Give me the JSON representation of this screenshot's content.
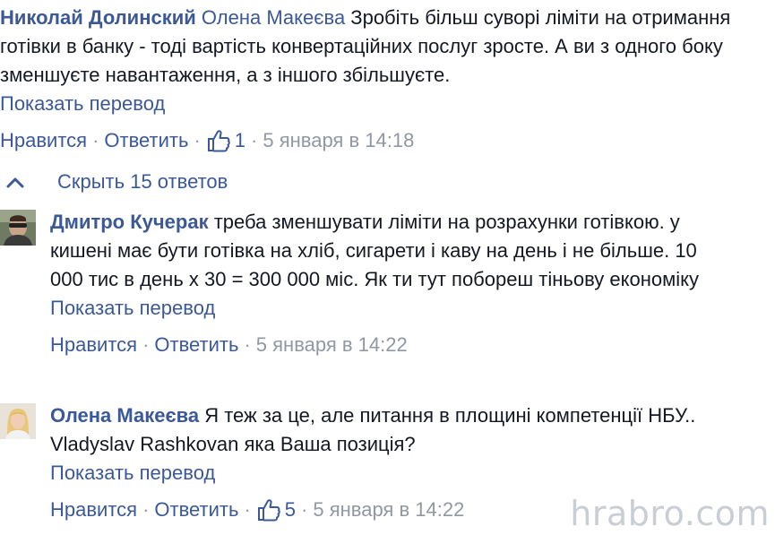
{
  "top_comment": {
    "author": "Николай Долинский",
    "mention": "Олена Макеєва",
    "text": " Зробіть більш суворі ліміти на отримання готівки в банку - тоді вартість конвертаційних послуг зросте. А ви з одного боку зменшуєте навантаження, а з іншого збільшуєте.",
    "translate": "Показать перевод",
    "like_label": "Нравится",
    "reply_label": "Ответить",
    "likes": "1",
    "time": "5 января в 14:18"
  },
  "replies_toggle": {
    "label": "Скрыть 15 ответов",
    "icon": "chevron-up-icon"
  },
  "replies": [
    {
      "author": "Дмитро Кучерак",
      "text": " треба зменшувати ліміти на розрахунки готівкою. у кишені має бути готівка на хліб, сигарети і каву на день і не більше. 10 000 тис в день х 30 = 300 000 міс. Як ти тут побореш тіньову економіку",
      "translate": "Показать перевод",
      "like_label": "Нравится",
      "reply_label": "Ответить",
      "time": "5 января в 14:22"
    },
    {
      "author": "Олена Макеєва",
      "text": " Я теж за це, але питання в площині компетенції НБУ.. Vladyslav Rashkovan яка Ваша позиція?",
      "translate": "Показать перевод",
      "like_label": "Нравится",
      "reply_label": "Ответить",
      "likes": "5",
      "time": "5 января в 14:22"
    }
  ],
  "watermark": "hrabro.com",
  "colors": {
    "link": "#3b5998",
    "meta": "#9197a3",
    "text": "#141823"
  }
}
